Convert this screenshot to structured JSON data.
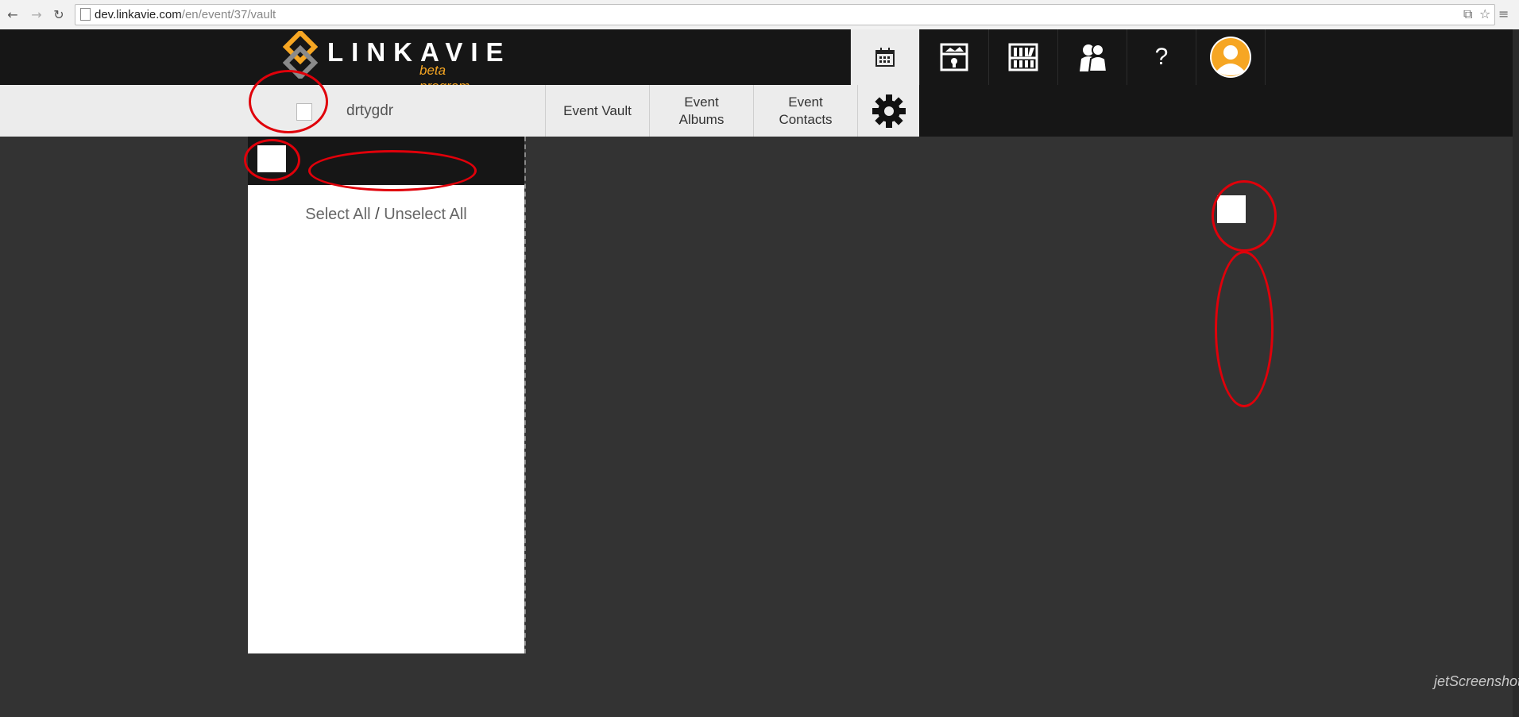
{
  "browser": {
    "back_icon": "back-arrow-icon",
    "forward_icon": "forward-arrow-icon",
    "reload_icon": "reload-icon",
    "url_host": "dev.linkavie.com",
    "url_path": "/en/event/37/vault"
  },
  "header": {
    "logo_text": "LINKAVIE",
    "logo_sub": "beta program",
    "help_label": "?",
    "accent_color": "#f6a623"
  },
  "subnav": {
    "event_name": "drtygdr",
    "tab_vault": "Event Vault",
    "tab_albums_line1": "Event",
    "tab_albums_line2": "Albums",
    "tab_contacts_line1": "Event",
    "tab_contacts_line2": "Contacts"
  },
  "panel": {
    "select_all": "Select All",
    "separator": "/",
    "unselect_all": "Unselect All"
  },
  "annotation_color": "#e0000a",
  "watermark": "jetScreenshot"
}
